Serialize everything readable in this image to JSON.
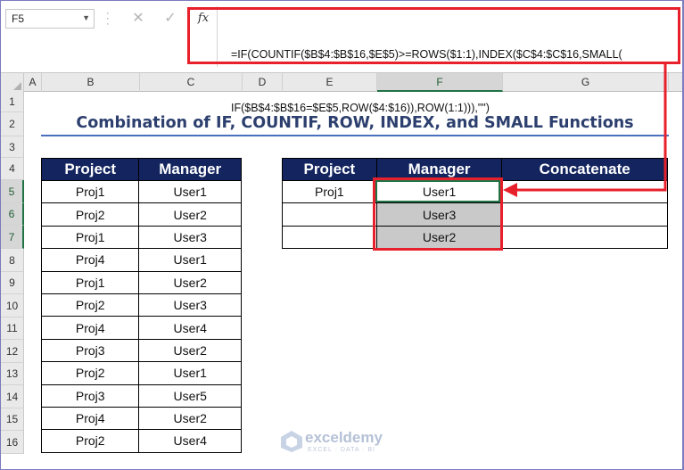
{
  "name_box": {
    "value": "F5",
    "dropdown_icon": "chevron-down-icon"
  },
  "formula_bar": {
    "cancel_icon": "close-icon",
    "enter_icon": "check-icon",
    "fx_label": "fx",
    "formula_line1": "=IF(COUNTIF($B$4:$B$16,$E$5)>=ROWS($1:1),INDEX($C$4:$C$16,SMALL(",
    "formula_line2": "IF($B$4:$B$16=$E$5,ROW($4:$16)),ROW(1:1))),\"\")"
  },
  "columns": [
    "A",
    "B",
    "C",
    "D",
    "E",
    "F",
    "G"
  ],
  "active_column": "F",
  "rows": [
    "1",
    "2",
    "3",
    "4",
    "5",
    "6",
    "7",
    "8",
    "9",
    "10",
    "11",
    "12",
    "13",
    "14",
    "15",
    "16"
  ],
  "active_rows": [
    "5",
    "6",
    "7"
  ],
  "title": "Combination of IF, COUNTIF, ROW, INDEX, and SMALL Functions",
  "left_table": {
    "headers": [
      "Project",
      "Manager"
    ],
    "rows": [
      [
        "Proj1",
        "User1"
      ],
      [
        "Proj2",
        "User2"
      ],
      [
        "Proj1",
        "User3"
      ],
      [
        "Proj4",
        "User1"
      ],
      [
        "Proj1",
        "User2"
      ],
      [
        "Proj2",
        "User3"
      ],
      [
        "Proj4",
        "User4"
      ],
      [
        "Proj3",
        "User2"
      ],
      [
        "Proj2",
        "User1"
      ],
      [
        "Proj3",
        "User5"
      ],
      [
        "Proj4",
        "User2"
      ],
      [
        "Proj2",
        "User4"
      ]
    ]
  },
  "right_table": {
    "headers": [
      "Project",
      "Manager",
      "Concatenate"
    ],
    "rows": [
      [
        "Proj1",
        "User1",
        ""
      ],
      [
        "",
        "User3",
        ""
      ],
      [
        "",
        "User2",
        ""
      ]
    ]
  },
  "watermark": {
    "name": "exceldemy",
    "tagline": "EXCEL · DATA · BI"
  },
  "colors": {
    "header_fill": "#13245e",
    "highlight_red": "#e8202b",
    "selection_green": "#217346",
    "shaded_cell": "#c9c9c9",
    "title_text": "#2c3f6e"
  }
}
